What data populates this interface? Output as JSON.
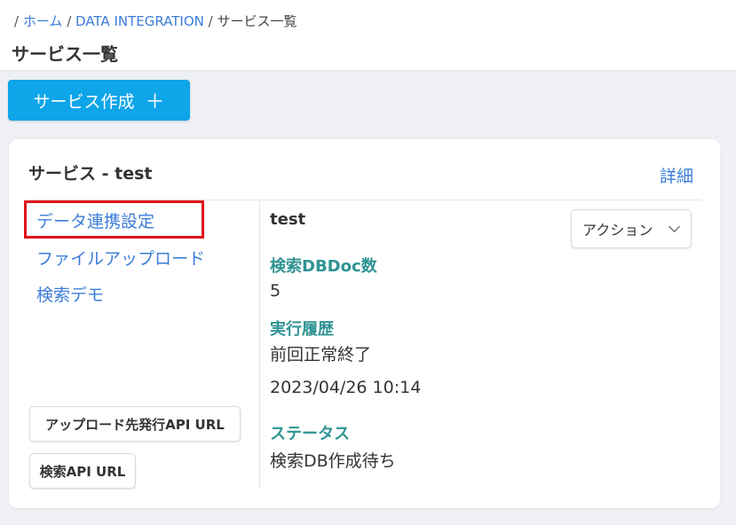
{
  "breadcrumb": {
    "sep": "/",
    "home": "ホーム",
    "integration": "DATA INTEGRATION",
    "current": "サービス一覧"
  },
  "page": {
    "title": "サービス一覧",
    "create_button": "サービス作成",
    "create_icon": "plus-icon"
  },
  "card": {
    "title": "サービス - test",
    "detail_link": "詳細",
    "nav": {
      "data_link": "データ連携設定",
      "file_upload": "ファイルアップロード",
      "search_demo": "検索デモ"
    },
    "buttons": {
      "upload_api": "アップロード先発行API URL",
      "search_api": "検索API URL"
    },
    "service_name": "test",
    "action_select": "アクション",
    "fields": {
      "doc_count_label": "検索DBDoc数",
      "doc_count_value": "5",
      "history_label": "実行履歴",
      "history_value": "前回正常終了",
      "history_time": "2023/04/26 10:14",
      "status_label": "ステータス",
      "status_value": "検索DB作成待ち"
    }
  },
  "colors": {
    "link": "#3b7dd8",
    "primary_button": "#0ea5e9",
    "field_label": "#2f9393",
    "highlight": "#e0141b"
  }
}
